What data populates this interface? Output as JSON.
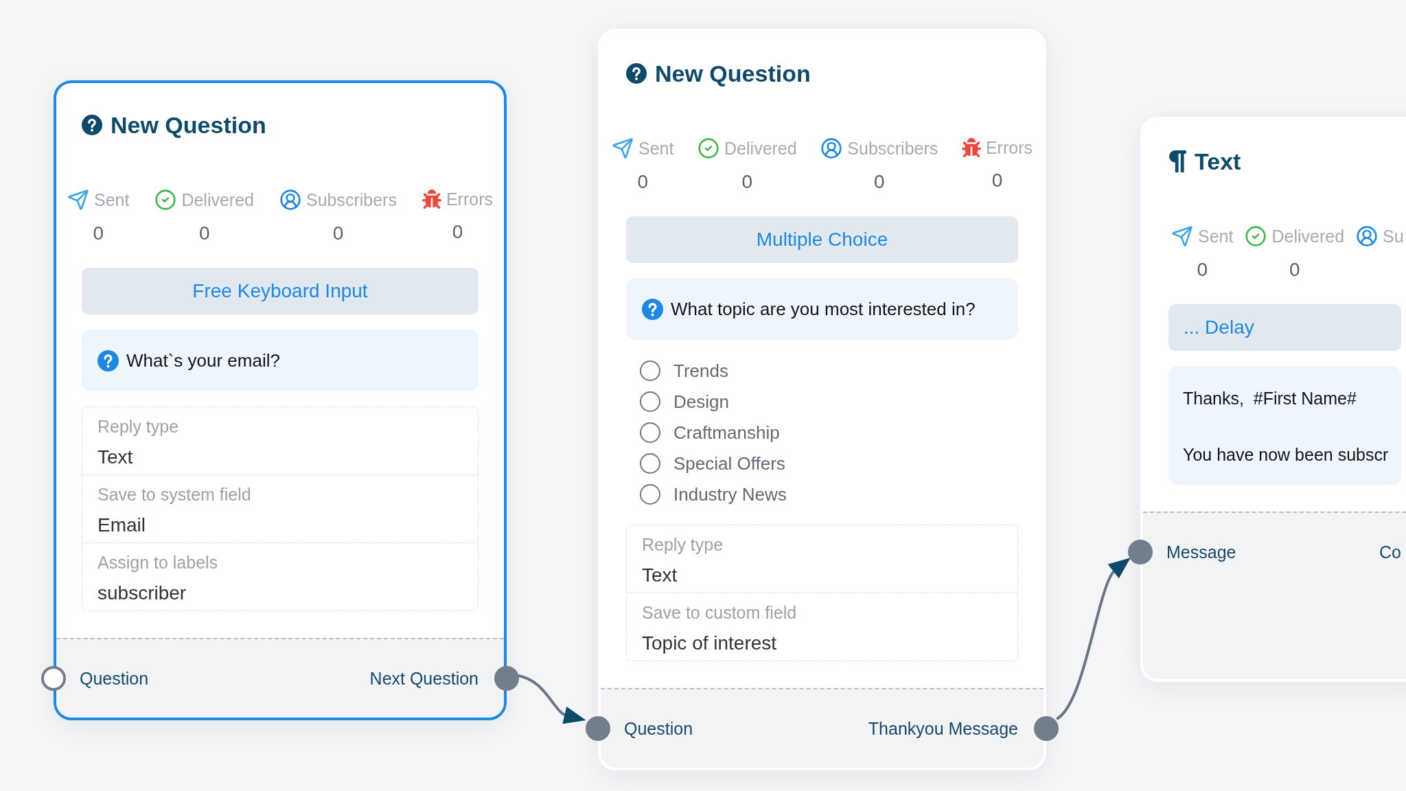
{
  "canvas": {
    "nodes": [
      {
        "kind": "question",
        "selected": true,
        "title": "New Question",
        "stats": [
          {
            "kind": "sent",
            "label": "Sent",
            "value": "0"
          },
          {
            "kind": "delivered",
            "label": "Delivered",
            "value": "0"
          },
          {
            "kind": "subscribers",
            "label": "Subscribers",
            "value": "0"
          },
          {
            "kind": "errors",
            "label": "Errors",
            "value": "0"
          }
        ],
        "type_button": {
          "label": "Free Keyboard Input"
        },
        "question": "What`s your email?",
        "fields": [
          {
            "label": "Reply type",
            "value": "Text"
          },
          {
            "label": "Save to system field",
            "value": "Email"
          },
          {
            "label": "Assign to labels",
            "value": "subscriber"
          }
        ],
        "input_port": {
          "label": "Question",
          "connected": false
        },
        "output_port": {
          "label": "Next Question",
          "connected": true
        }
      },
      {
        "kind": "question",
        "selected": false,
        "title": "New Question",
        "stats": [
          {
            "kind": "sent",
            "label": "Sent",
            "value": "0"
          },
          {
            "kind": "delivered",
            "label": "Delivered",
            "value": "0"
          },
          {
            "kind": "subscribers",
            "label": "Subscribers",
            "value": "0"
          },
          {
            "kind": "errors",
            "label": "Errors",
            "value": "0"
          }
        ],
        "type_button": {
          "label": "Multiple Choice"
        },
        "question": "What topic are you most interested in?",
        "options": [
          {
            "label": "Trends",
            "selected": false
          },
          {
            "label": "Design",
            "selected": false
          },
          {
            "label": "Craftmanship",
            "selected": false
          },
          {
            "label": "Special Offers",
            "selected": false
          },
          {
            "label": "Industry News",
            "selected": false
          }
        ],
        "fields": [
          {
            "label": "Reply type",
            "value": "Text"
          },
          {
            "label": "Save to custom field",
            "value": "Topic of interest"
          }
        ],
        "input_port": {
          "label": "Question",
          "connected": true
        },
        "output_port": {
          "label": "Thankyou Message",
          "connected": true
        }
      },
      {
        "kind": "text",
        "selected": false,
        "title": "Text",
        "stats": [
          {
            "kind": "sent",
            "label": "Sent",
            "value": "0"
          },
          {
            "kind": "delivered",
            "label": "Delivered",
            "value": "0"
          },
          {
            "kind": "subscribers",
            "label": "Su"
          }
        ],
        "type_button": {
          "label": "... Delay"
        },
        "message": "Thanks,  #First Name#\n\nYou have now been subscr",
        "input_port": {
          "label": "Message",
          "connected": true
        },
        "output_port": {
          "label": "Co"
        }
      }
    ]
  }
}
